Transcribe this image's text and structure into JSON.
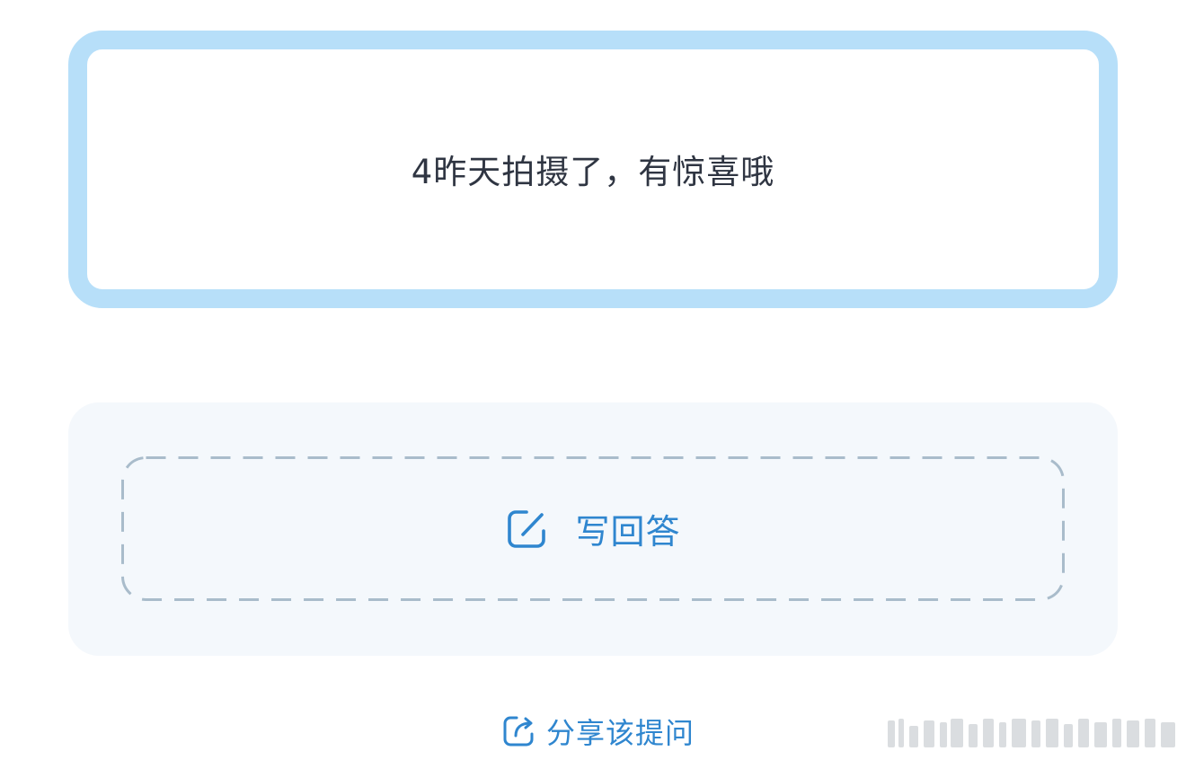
{
  "question": {
    "text": "4昨天拍摄了，有惊喜哦"
  },
  "answer_button": {
    "label": "写回答",
    "icon": "edit-icon"
  },
  "share": {
    "label": "分享该提问",
    "icon": "share-icon"
  },
  "colors": {
    "card_border": "#b7dff9",
    "panel_background": "#f4f8fc",
    "accent": "#2f86cf",
    "dash_border": "#a9bccb",
    "question_text": "#2f3542"
  }
}
